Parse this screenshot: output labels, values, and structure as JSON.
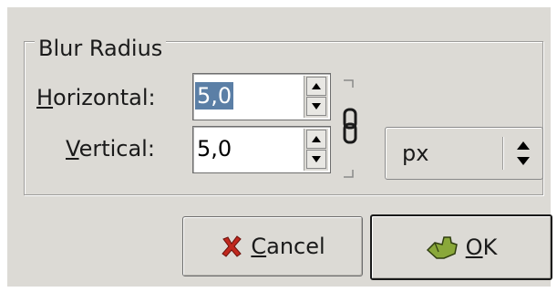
{
  "group": {
    "title": "Blur Radius"
  },
  "horizontal": {
    "mnemonic": "H",
    "label_rest": "orizontal:",
    "value": "5,0"
  },
  "vertical": {
    "mnemonic": "V",
    "label_rest": "ertical:",
    "value": "5,0"
  },
  "unit": {
    "selected": "px"
  },
  "buttons": {
    "cancel": {
      "mnemonic": "C",
      "label_rest": "ancel"
    },
    "ok": {
      "mnemonic": "O",
      "label_rest": "K"
    }
  },
  "icons": {
    "chain": "chain-link-icon",
    "cancel": "x-cross-icon",
    "ok": "ok-hand-icon",
    "spin_up": "arrow-up-icon",
    "spin_down": "arrow-down-icon"
  },
  "colors": {
    "background": "#dcdad5",
    "selection": "#5b7fa6",
    "cancel_icon": "#c0281e",
    "ok_icon": "#8aa83a"
  }
}
